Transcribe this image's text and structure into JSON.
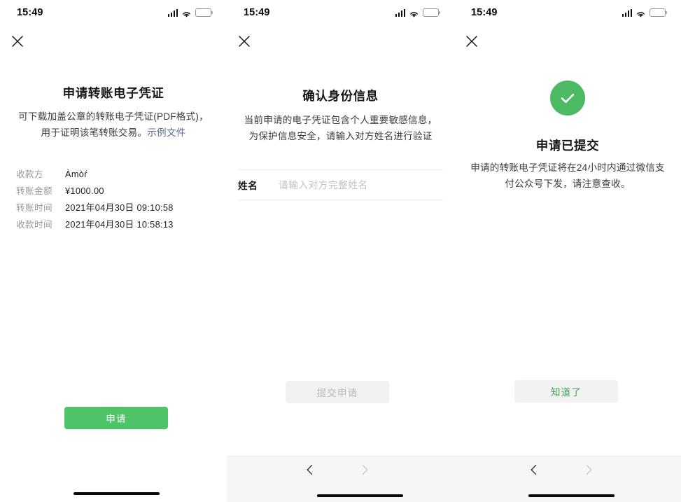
{
  "status_bar": {
    "time": "15:49",
    "signal_icon": "signal-bars-icon",
    "wifi_icon": "wifi-icon",
    "battery_icon": "battery-icon"
  },
  "colors": {
    "brand_green": "#4fc368",
    "success_green": "#4cb963",
    "link_blue": "#5b6b8c",
    "disabled_gray": "#f1f1f1",
    "disabled_text": "#b9b9b9"
  },
  "screen1": {
    "close_label": "close-icon",
    "title": "申请转账电子凭证",
    "description_line1": "可下载加盖公章的转账电子凭证(PDF格式)，",
    "description_line2": "用于证明该笔转账交易。",
    "link_label": "示例文件",
    "info_rows": [
      {
        "label": "收款方",
        "value": "Àmòŕ"
      },
      {
        "label": "转账金额",
        "value": "¥1000.00"
      },
      {
        "label": "转账时间",
        "value": "2021年04月30日  09:10:58"
      },
      {
        "label": "收款时间",
        "value": "2021年04月30日  10:58:13"
      }
    ],
    "primary_button": "申请"
  },
  "screen2": {
    "close_label": "close-icon",
    "title": "确认身份信息",
    "description_line1": "当前申请的电子凭证包含个人重要敏感信息，",
    "description_line2": "为保护信息安全，请输入对方姓名进行验证",
    "field": {
      "label": "姓名",
      "value": "",
      "placeholder": "请输入对方完整姓名"
    },
    "submit_button": "提交申请",
    "accessory": {
      "back_icon": "chevron-left-icon",
      "forward_icon": "chevron-right-icon"
    }
  },
  "screen3": {
    "close_label": "close-icon",
    "success_icon": "check-circle-icon",
    "title": "申请已提交",
    "description_line1": "申请的转账电子凭证将在24小时内通过微信支",
    "description_line2": "付公众号下发，请注意查收。",
    "confirm_button": "知道了",
    "accessory": {
      "back_icon": "chevron-left-icon",
      "forward_icon": "chevron-right-icon"
    }
  }
}
